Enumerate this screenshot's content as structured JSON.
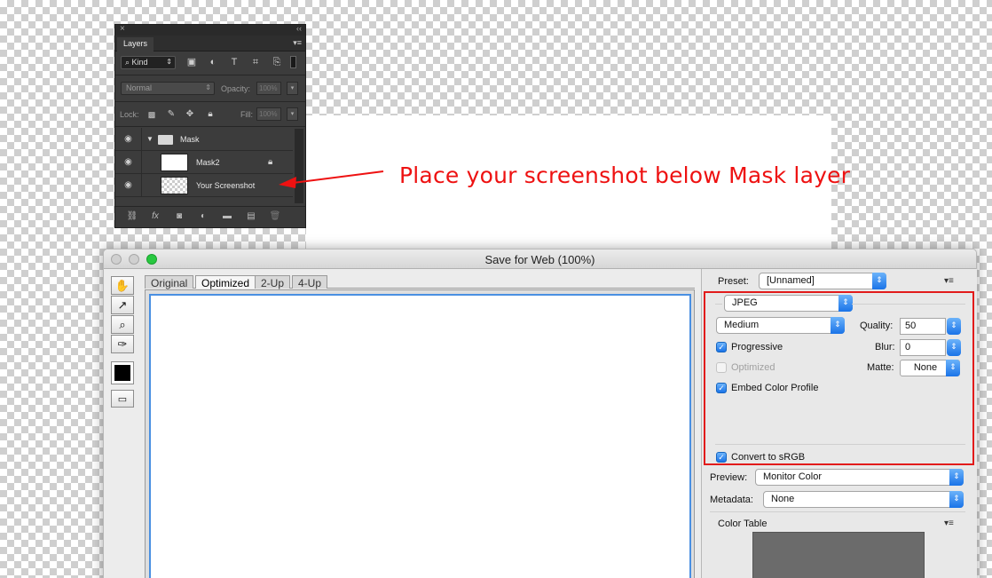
{
  "layers_panel": {
    "close_glyph": "×",
    "collapse_glyph": "‹‹",
    "tab_label": "Layers",
    "menu_glyph": "▾≡",
    "filter_kind": "Kind",
    "blend_mode": "Normal",
    "opacity_label": "Opacity:",
    "opacity_value": "100%",
    "lock_label": "Lock:",
    "fill_label": "Fill:",
    "fill_value": "100%",
    "layers": [
      {
        "name": "Mask",
        "type": "group"
      },
      {
        "name": "Mask2",
        "type": "layer",
        "locked": true
      },
      {
        "name": "Your Screenshot",
        "type": "layer"
      }
    ]
  },
  "annotation": {
    "text": "Place your screenshot below Mask layer",
    "color": "#ee1111"
  },
  "save_for_web": {
    "title": "Save for Web (100%)",
    "tabs": [
      "Original",
      "Optimized",
      "2-Up",
      "4-Up"
    ],
    "active_tab": "Optimized",
    "preset_label": "Preset:",
    "preset_value": "[Unnamed]",
    "format": "JPEG",
    "quality_level": "Medium",
    "quality_label": "Quality:",
    "quality_value": "50",
    "progressive_label": "Progressive",
    "progressive_checked": true,
    "blur_label": "Blur:",
    "blur_value": "0",
    "optimized_label": "Optimized",
    "optimized_checked": false,
    "matte_label": "Matte:",
    "matte_value": "None",
    "embed_label": "Embed Color Profile",
    "embed_checked": true,
    "srgb_label": "Convert to sRGB",
    "srgb_checked": true,
    "preview_label": "Preview:",
    "preview_value": "Monitor Color",
    "metadata_label": "Metadata:",
    "metadata_value": "None",
    "color_table_label": "Color Table",
    "highlight_color": "#e21b1b",
    "accent_color": "#1a73e8"
  }
}
